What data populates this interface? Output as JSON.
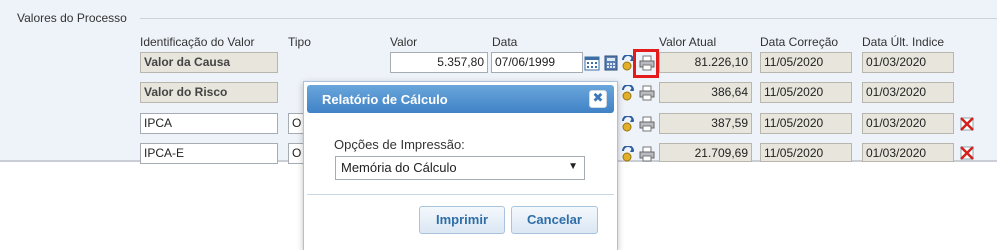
{
  "fieldset": {
    "legend": "Valores do Processo"
  },
  "headers": {
    "identificacao": "Identificação do Valor",
    "tipo": "Tipo",
    "valor": "Valor",
    "data": "Data",
    "valor_atual": "Valor Atual",
    "data_correcao": "Data Correção",
    "data_ult_indice": "Data Últ. Indice"
  },
  "rows": [
    {
      "name": "Valor da Causa",
      "tipo": "",
      "valor": "5.357,80",
      "data": "07/06/1999",
      "valor_atual": "81.226,10",
      "data_correcao": "11/05/2020",
      "data_ult_indice": "01/03/2020"
    },
    {
      "name": "Valor do Risco",
      "tipo": "",
      "valor": "",
      "data": "",
      "valor_atual": "386,64",
      "data_correcao": "11/05/2020",
      "data_ult_indice": "01/03/2020"
    },
    {
      "name": "IPCA",
      "tipo": "O",
      "valor": "",
      "data": "",
      "valor_atual": "387,59",
      "data_correcao": "11/05/2020",
      "data_ult_indice": "01/03/2020"
    },
    {
      "name": "IPCA-E",
      "tipo": "O",
      "valor": "",
      "data": "",
      "valor_atual": "21.709,69",
      "data_correcao": "11/05/2020",
      "data_ult_indice": "01/03/2020"
    }
  ],
  "dialog": {
    "title": "Relatório de Cálculo",
    "close_glyph": "✖",
    "print_options_label": "Opções de Impressão:",
    "print_option_selected": "Memória do Cálculo",
    "print_button": "Imprimir",
    "cancel_button": "Cancelar"
  },
  "icons": {
    "calendar": "calendar-icon",
    "calculator": "calculator-icon",
    "recalculate": "recalculate-icon",
    "print": "printer-icon",
    "delete": "delete-icon"
  },
  "colors": {
    "dialog_title_bg": "#4a8ccc",
    "highlight": "#e31b1b",
    "readonly_bg": "#e7e5dc"
  }
}
